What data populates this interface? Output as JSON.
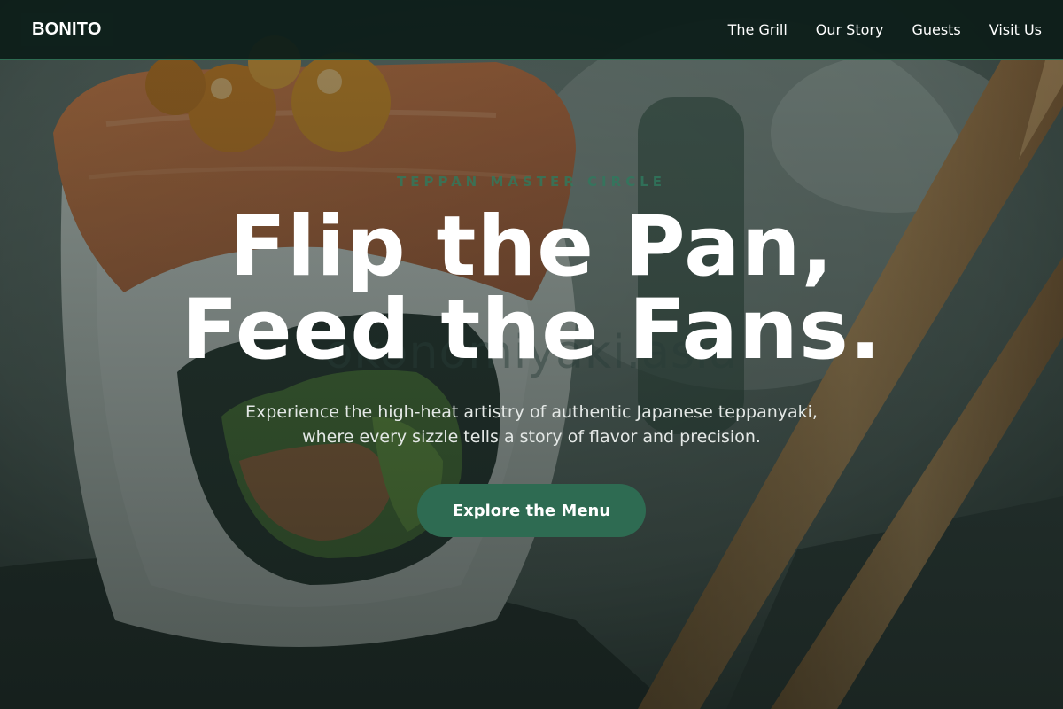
{
  "header": {
    "logo_text": "BONITO",
    "nav": [
      {
        "label": "The Grill"
      },
      {
        "label": "Our Story"
      },
      {
        "label": "Guests"
      },
      {
        "label": "Visit Us"
      }
    ]
  },
  "hero": {
    "eyebrow": "TEPPAN MASTER CIRCLE",
    "headline_line1": "Flip the Pan,",
    "headline_line2": "Feed the Fans.",
    "watermark": "okonomiyaki.asia",
    "subtitle": "Experience the high-heat artistry of authentic Japanese teppanyaki, where every sizzle tells a story of flavor and precision.",
    "cta_label": "Explore the Menu"
  },
  "colors": {
    "accent": "#2e6b52",
    "header_bg": "#0e1e1a",
    "text": "#ffffff"
  }
}
